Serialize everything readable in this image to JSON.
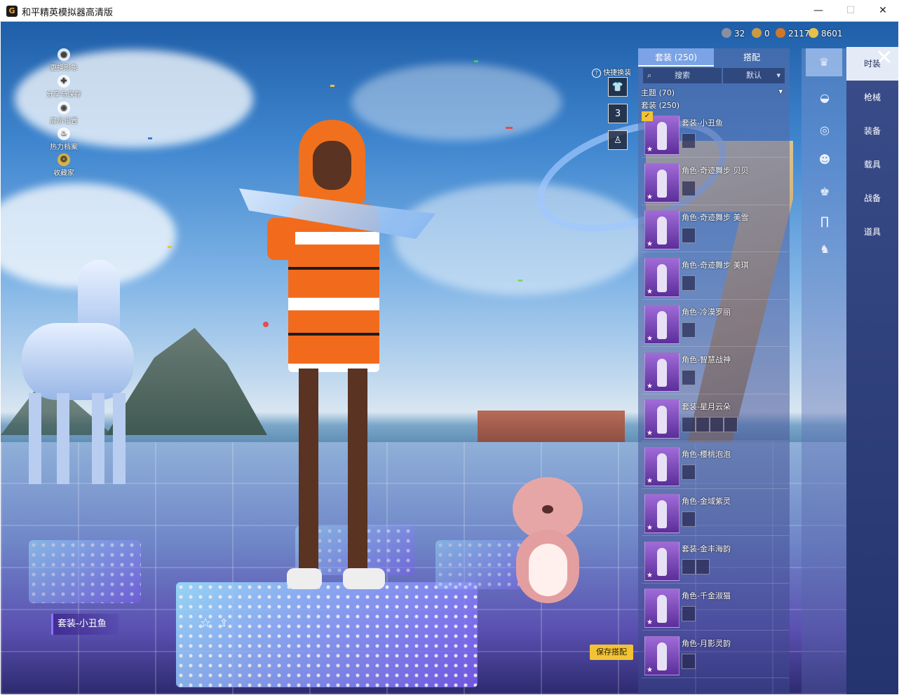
{
  "window": {
    "app_icon": "G",
    "title": "和平精英模拟器高清版",
    "controls": {
      "minimize": "—",
      "maximize": "☐",
      "close": "✕"
    }
  },
  "left_menu": [
    {
      "label": "更换形象",
      "icon": "person-icon",
      "glyph": "●"
    },
    {
      "label": "分享与保存",
      "icon": "share-icon",
      "glyph": "✚"
    },
    {
      "label": "展示设置",
      "icon": "eye-icon",
      "glyph": "◉"
    },
    {
      "label": "热力档案",
      "icon": "flame-icon",
      "glyph": "♨"
    },
    {
      "label": "收藏家",
      "icon": "badge-icon",
      "glyph": "✪"
    }
  ],
  "currencies": [
    {
      "value": "32",
      "icon": "coin-dark-icon",
      "color": "#8a8fa0"
    },
    {
      "value": "0",
      "icon": "coin-bronze-icon",
      "color": "#c79a45"
    },
    {
      "value": "2117",
      "icon": "coin-orange-icon",
      "color": "#d1772c"
    },
    {
      "value": "8601",
      "icon": "coin-gold-icon",
      "color": "#e5c24a"
    }
  ],
  "quick_change": {
    "label": "快捷换装",
    "help_icon": "?",
    "buttons": [
      {
        "icon": "outfit-slot-1-icon",
        "glyph": "👕"
      },
      {
        "icon": "outfit-slot-3-icon",
        "glyph": "3"
      },
      {
        "icon": "figure-icon",
        "glyph": "♙"
      }
    ]
  },
  "list_panel": {
    "tabs": [
      {
        "label": "套装 (250)",
        "active": true
      },
      {
        "label": "搭配",
        "active": false
      }
    ],
    "search_icon": "⌕",
    "search_placeholder": "搜索",
    "sort_value": "默认",
    "sort_arrow": "▾",
    "theme_label": "主题 (70)",
    "theme_arrow": "▾",
    "sets_label": "套装 (250)",
    "check_glyph": "✓",
    "items": [
      {
        "label": "套装-小丑鱼",
        "selected": true,
        "minis": 1
      },
      {
        "label": "角色-奇迹舞步 贝贝",
        "selected": false,
        "minis": 1
      },
      {
        "label": "角色-奇迹舞步 美雪",
        "selected": false,
        "minis": 1
      },
      {
        "label": "角色-奇迹舞步 美琪",
        "selected": false,
        "minis": 1
      },
      {
        "label": "角色-冷漠罗丽",
        "selected": false,
        "minis": 1
      },
      {
        "label": "角色-智慧战神",
        "selected": false,
        "minis": 1
      },
      {
        "label": "套装-星月云朵",
        "selected": false,
        "minis": 4
      },
      {
        "label": "角色-樱桃泡泡",
        "selected": false,
        "minis": 1
      },
      {
        "label": "角色-金域紫灵",
        "selected": false,
        "minis": 1
      },
      {
        "label": "套装-金丰海韵",
        "selected": false,
        "minis": 2
      },
      {
        "label": "角色-千金淑猫",
        "selected": false,
        "minis": 1
      },
      {
        "label": "角色-月影灵韵",
        "selected": false,
        "minis": 1
      }
    ]
  },
  "category_icons": [
    {
      "icon": "outfit-icon",
      "glyph": "♛",
      "selected": true
    },
    {
      "icon": "hat-icon",
      "glyph": "◒",
      "selected": false
    },
    {
      "icon": "glasses-icon",
      "glyph": "◎",
      "selected": false
    },
    {
      "icon": "face-icon",
      "glyph": "☻",
      "selected": false
    },
    {
      "icon": "top-icon",
      "glyph": "♚",
      "selected": false
    },
    {
      "icon": "pants-icon",
      "glyph": "∏",
      "selected": false
    },
    {
      "icon": "shoes-icon",
      "glyph": "♞",
      "selected": false
    }
  ],
  "side_tabs": [
    {
      "label": "时装",
      "active": true
    },
    {
      "label": "枪械",
      "active": false
    },
    {
      "label": "装备",
      "active": false
    },
    {
      "label": "载具",
      "active": false
    },
    {
      "label": "战备",
      "active": false
    },
    {
      "label": "道具",
      "active": false
    }
  ],
  "close_glyph": "✕",
  "outfit_name": "套装-小丑鱼",
  "favorite_glyph": "☆",
  "share_glyph": "⇪",
  "save_button": "保存搭配",
  "colors": {
    "accent_gold": "#f2c335",
    "active_tab_bg": "#e4ebf7",
    "side_bg": "#2b3b78"
  }
}
